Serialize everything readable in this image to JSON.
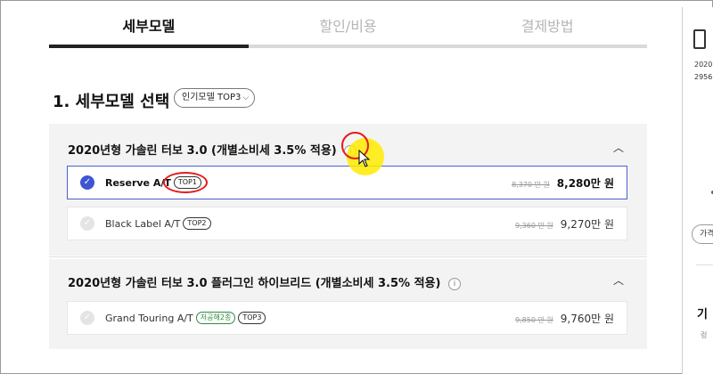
{
  "tabs": [
    {
      "label": "세부모델",
      "active": true
    },
    {
      "label": "할인/비용",
      "active": false
    },
    {
      "label": "결제방법",
      "active": false
    }
  ],
  "section": {
    "title": "1. 세부모델 선택",
    "filter_label": "인기모델 TOP3"
  },
  "groups": [
    {
      "title": "2020년형 가솔린 터보 3.0 (개별소비세 3.5% 적용)",
      "info": "i",
      "options": [
        {
          "name": "Reserve A/T",
          "tags": [
            "TOP1"
          ],
          "orig_price": "8,370 만 원",
          "price": "8,280만 원",
          "selected": true
        },
        {
          "name": "Black Label A/T",
          "tags": [
            "TOP2"
          ],
          "orig_price": "9,360 만 원",
          "price": "9,270만 원",
          "selected": false
        }
      ]
    },
    {
      "title": "2020년형 가솔린 터보 3.0 플러그인 하이브리드 (개별소비세 3.5% 적용)",
      "info": "i",
      "options": [
        {
          "name": "Grand Touring A/T",
          "tags": [
            "저공해2종",
            "TOP3"
          ],
          "orig_price": "9,850 만 원",
          "price": "9,760만 원",
          "selected": false
        }
      ]
    }
  ],
  "sidebar": {
    "text1": "2020",
    "text2": "2956",
    "pill": "가격",
    "heading": "기",
    "sub": "렁"
  },
  "colors": {
    "accent": "#3d55d4",
    "annotation": "#e41b1b",
    "highlight": "#ffeb00",
    "eco_tag": "#2f8a3e"
  }
}
